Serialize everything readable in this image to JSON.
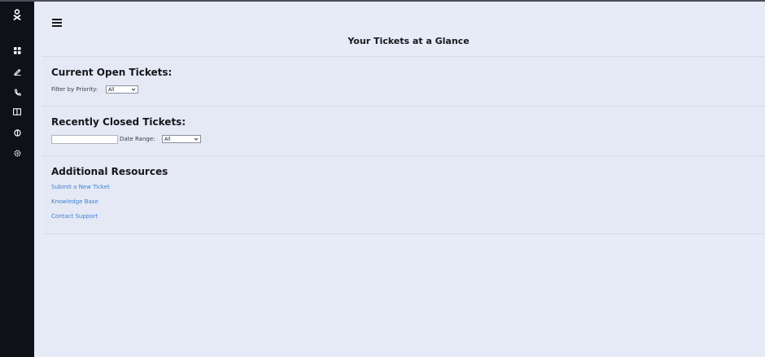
{
  "header": {
    "title": "Your Tickets at a Glance"
  },
  "sidebar": {
    "icons": [
      "logo-icon",
      "grid-icon",
      "pencil-icon",
      "phone-icon",
      "book-icon",
      "support-icon",
      "settings-icon"
    ]
  },
  "open_tickets": {
    "heading": "Current Open Tickets:",
    "filter_label": "Filter by Priority:",
    "priority_selected": "All"
  },
  "closed_tickets": {
    "heading": "Recently Closed Tickets:",
    "date_range_label": "Date Range:",
    "date_range_selected": "All",
    "search_value": ""
  },
  "resources": {
    "heading": "Additional Resources",
    "links": [
      "Submit a New Ticket",
      "Knowledge Base",
      "Contact Support"
    ]
  },
  "colors": {
    "sidebar": "#0f1118",
    "background": "#e7ebf7",
    "link": "#3e7fd6"
  }
}
